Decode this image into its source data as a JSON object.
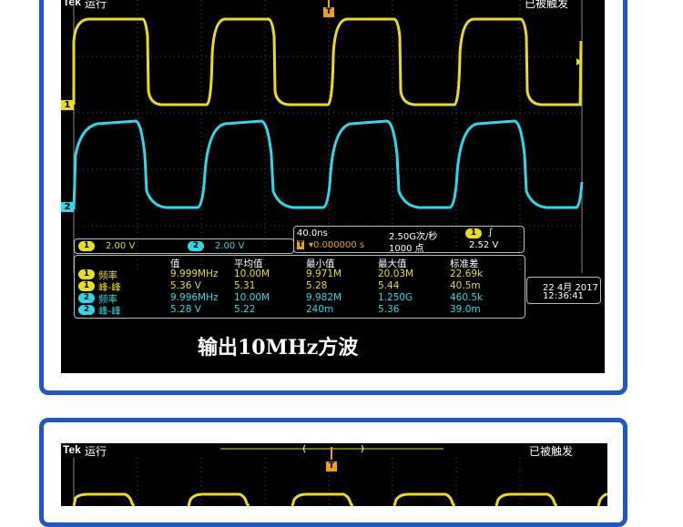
{
  "scope1": {
    "brand": "Tek",
    "run_state": "运行",
    "trigger_state": "已被触发",
    "trigger_marker": "T",
    "ch1_marker": "1",
    "ch2_marker": "2",
    "ch1_scale": {
      "badge": "1",
      "value": "2.00 V"
    },
    "ch2_scale": {
      "badge": "2",
      "value": "2.00 V"
    },
    "timebase": "40.0ns",
    "sample_rate": "2.50G次/秒",
    "record_length": "1000 点",
    "trigger_position": "▾0.000000 s",
    "trigger_source": {
      "badge": "1",
      "slope": "∫",
      "level": "2.52 V"
    },
    "measurements": {
      "headers": [
        "值",
        "平均值",
        "最小值",
        "最大值",
        "标准差"
      ],
      "rows": [
        {
          "ch": "1",
          "name": "频率",
          "value": "9.999MHz",
          "mean": "10.00M",
          "min": "9.971M",
          "max": "20.03M",
          "std": "22.69k"
        },
        {
          "ch": "1",
          "name": "峰-峰",
          "value": "5.36 V",
          "mean": "5.31",
          "min": "5.28",
          "max": "5.44",
          "std": "40.5m"
        },
        {
          "ch": "2",
          "name": "频率",
          "value": "9.996MHz",
          "mean": "10.00M",
          "min": "9.982M",
          "max": "1.250G",
          "std": "460.5k"
        },
        {
          "ch": "2",
          "name": "峰-峰",
          "value": "5.28 V",
          "mean": "5.22",
          "min": "240m",
          "max": "5.36",
          "std": "39.0m"
        }
      ]
    },
    "date": "22 4月 2017",
    "time": "12:36:41",
    "caption": "输出10MHz方波",
    "colors": {
      "ch1": "#e8dc1f",
      "ch2": "#2fd8e8",
      "frame": "#1f57c9"
    }
  },
  "scope2": {
    "brand": "Tek",
    "run_state": "运行",
    "trigger_state": "已被触发",
    "trigger_marker": "T"
  }
}
